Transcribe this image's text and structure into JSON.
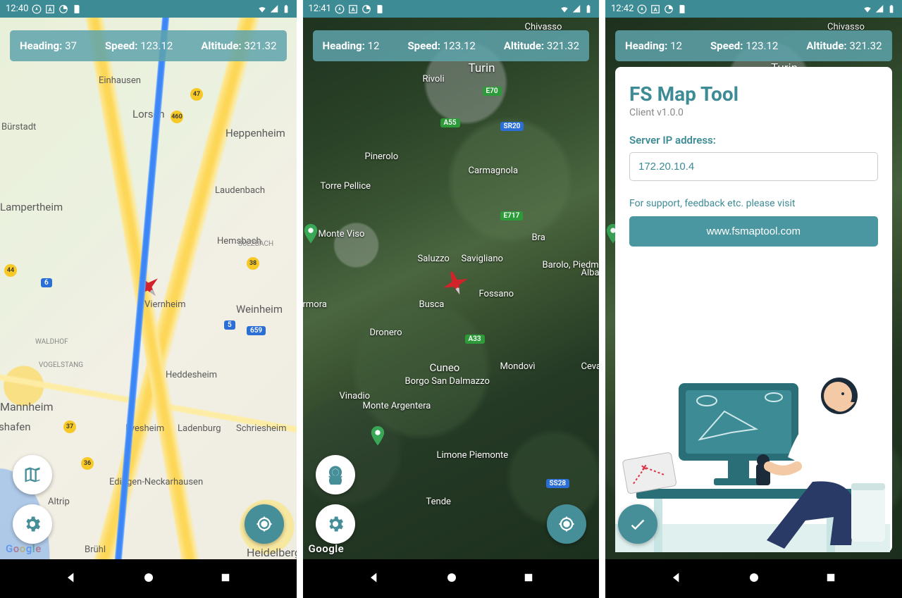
{
  "screens": [
    {
      "time": "12:40",
      "info": {
        "heading_label": "Heading:",
        "heading": "37",
        "speed_label": "Speed:",
        "speed": "123.12",
        "alt_label": "Altitude:",
        "alt": "321.32"
      },
      "google": "Google",
      "cities": [
        "Einhausen",
        "Lorsch",
        "Bürstadt",
        "Heppenheim",
        "Laudenbach",
        "Lampertheim",
        "Hemsbach",
        "SULZBACH",
        "Viernheim",
        "Weinheim",
        "WALDHOF",
        "VOGELSTANG",
        "Heddesheim",
        "Mannheim",
        "Ilvesheim",
        "Ladenburg",
        "Schriesheim",
        "igshafen",
        "Edingen-Neckarhausen",
        "Altrip",
        "Brühl",
        "Heidelberg"
      ],
      "roads": [
        "47",
        "460",
        "38",
        "6",
        "5",
        "659",
        "37",
        "36"
      ]
    },
    {
      "time": "12:41",
      "info": {
        "heading_label": "Heading:",
        "heading": "12",
        "speed_label": "Speed:",
        "speed": "123.12",
        "alt_label": "Altitude:",
        "alt": "321.32"
      },
      "google": "Google",
      "cities": [
        "Chivasso",
        "Turin",
        "Rivoli",
        "Pinerolo",
        "Carmagnola",
        "Torre Pellice",
        "Monte Viso",
        "Bra",
        "Alba",
        "Saluzzo",
        "Savigliano",
        "Barolo, Piedmont",
        "Busca",
        "Fossano",
        "Dronero",
        "Cuneo",
        "Mondovì",
        "Ceva",
        "rmora",
        "Vinadio",
        "Borgo San Dalmazzo",
        "Monte Argentera",
        "Limone Piemonte",
        "Tende"
      ],
      "roads": [
        "E70",
        "A55",
        "SR20",
        "E717",
        "A33",
        "SS28"
      ]
    },
    {
      "time": "12:42",
      "info": {
        "heading_label": "Heading:",
        "heading": "12",
        "speed_label": "Speed:",
        "speed": "123.12",
        "alt_label": "Altitude:",
        "alt": "321.32"
      },
      "title": "FS Map Tool",
      "version": "Client v1.0.0",
      "ip_label": "Server IP address:",
      "ip_value": "172.20.10.4",
      "support_text": "For support, feedback etc. please visit",
      "link": "www.fsmaptool.com",
      "cities": [
        "Chivasso",
        "Turin"
      ]
    }
  ]
}
